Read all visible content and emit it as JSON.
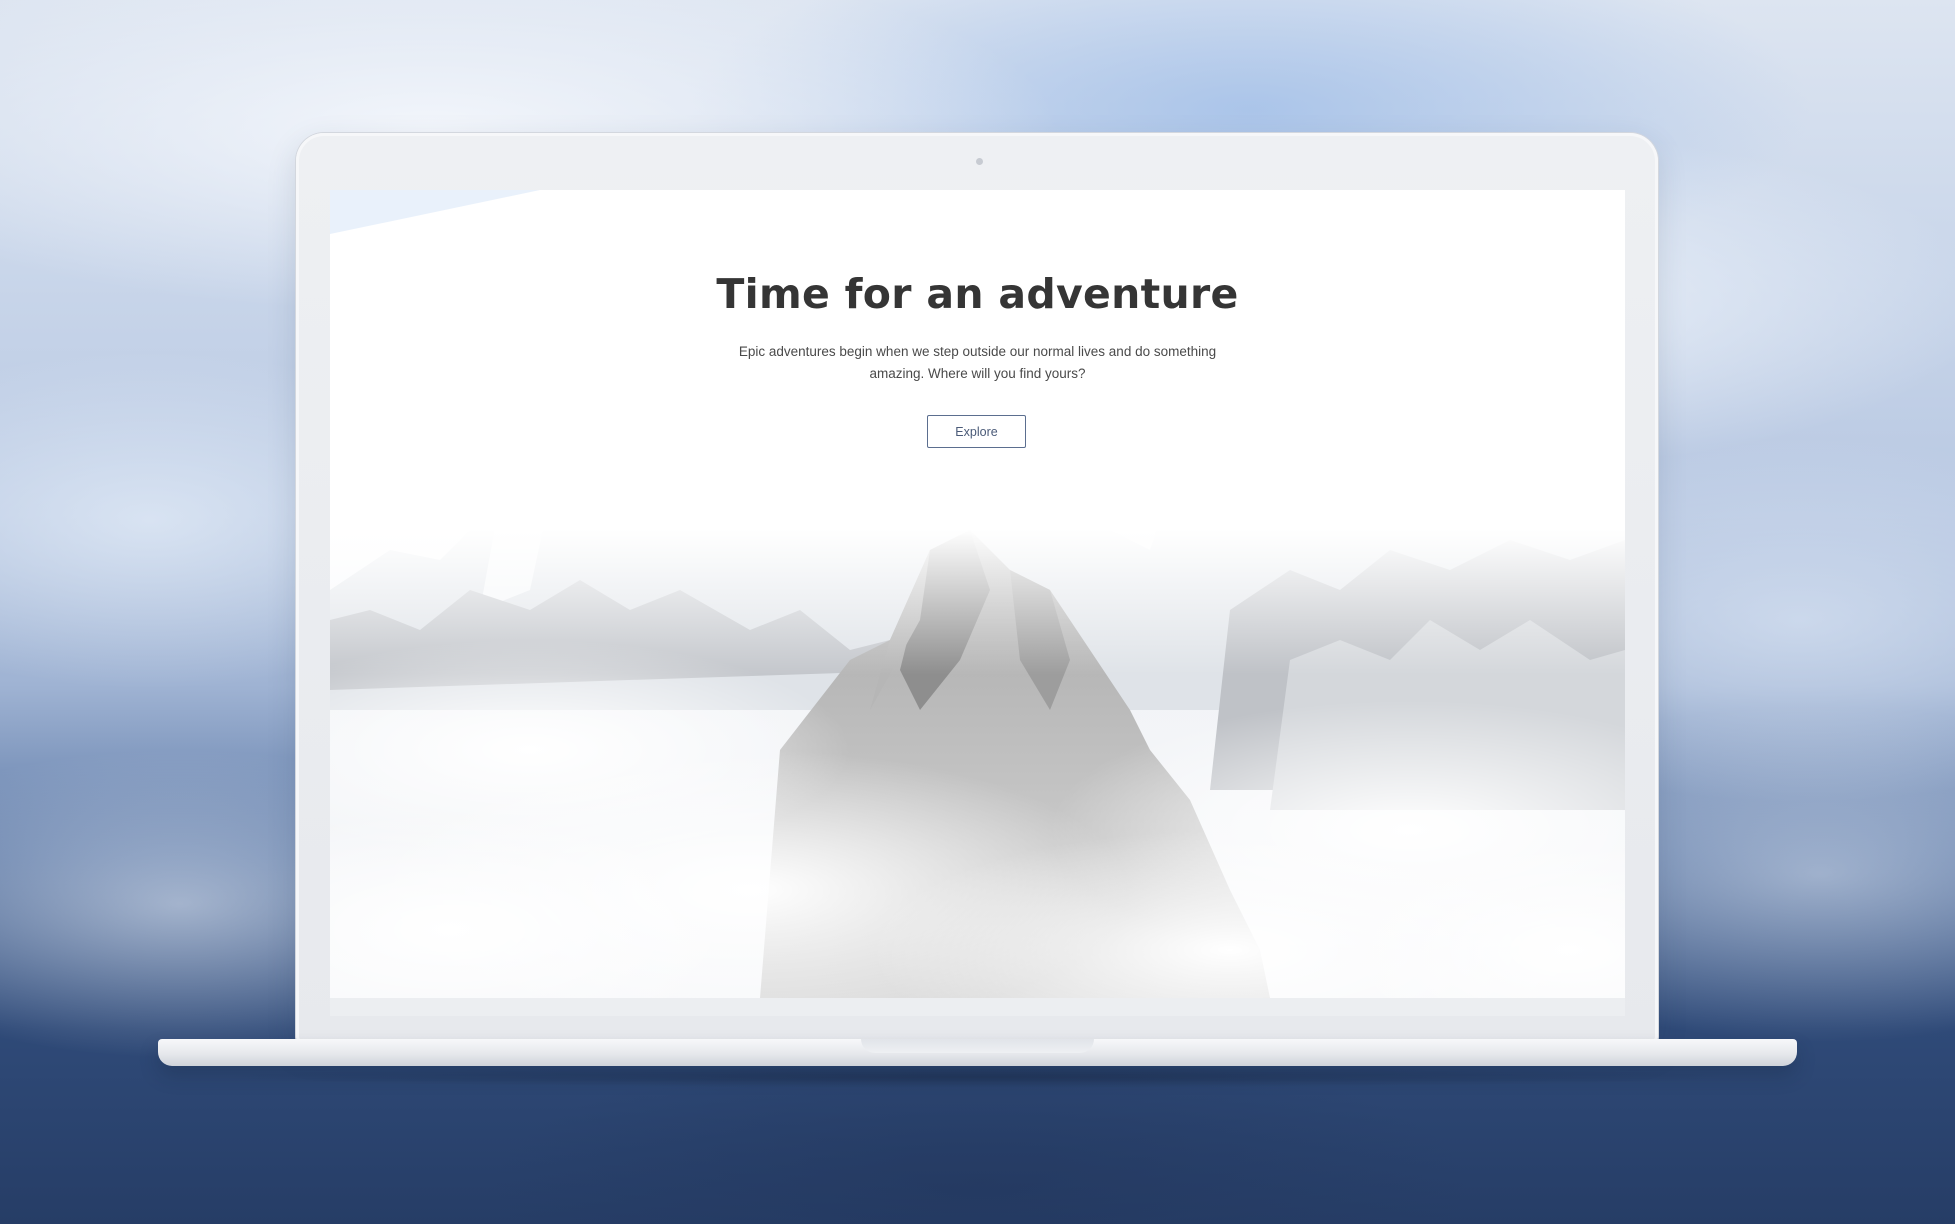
{
  "hero": {
    "title": "Time for an adventure",
    "subtitle_line1": "Epic adventures begin when we step outside our normal lives and do something",
    "subtitle_line2": "amazing. Where will you find yours?",
    "cta_label": "Explore"
  },
  "colors": {
    "title": "#353535",
    "button_border": "#5b6e8f",
    "backdrop_sky": "#c9d6ea",
    "backdrop_deep": "#263d66"
  },
  "icons": {
    "camera": "webcam-dot"
  }
}
